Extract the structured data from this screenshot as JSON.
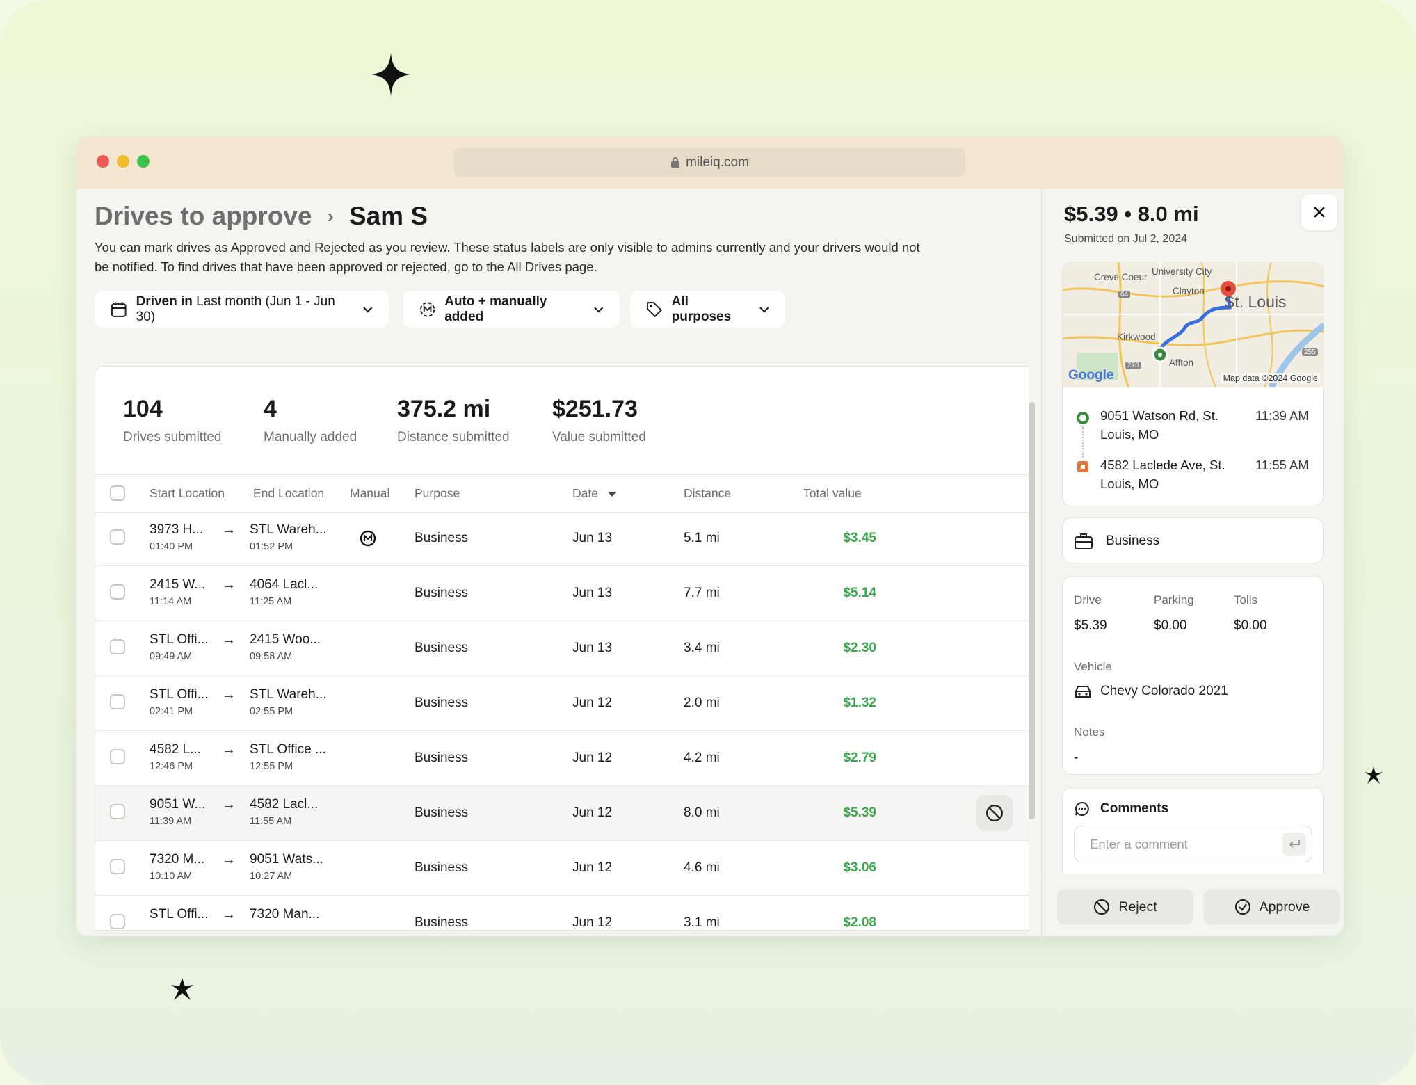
{
  "browser": {
    "url": "mileiq.com"
  },
  "breadcrumb": {
    "parent": "Drives to approve",
    "current": "Sam S"
  },
  "description": "You can mark drives as Approved and Rejected as you review. These status labels are only visible to admins currently and your drivers would not be notified. To find drives that have been approved or rejected, go to the All Drives page.",
  "filters": {
    "date_bold": "Driven in",
    "date_value": "Last month (Jun 1 - Jun 30)",
    "source": "Auto + manually added",
    "purpose": "All purposes"
  },
  "stats": [
    {
      "value": "104",
      "label": "Drives submitted"
    },
    {
      "value": "4",
      "label": "Manually added"
    },
    {
      "value": "375.2 mi",
      "label": "Distance submitted"
    },
    {
      "value": "$251.73",
      "label": "Value submitted"
    }
  ],
  "table": {
    "columns": [
      "Start Location",
      "End Location",
      "Manual",
      "Purpose",
      "Date",
      "Distance",
      "Total value"
    ],
    "rows": [
      {
        "start": "3973 H...",
        "start_time": "01:40 PM",
        "end": "STL Wareh...",
        "end_time": "01:52 PM",
        "manual": true,
        "purpose": "Business",
        "date": "Jun 13",
        "distance": "5.1 mi",
        "value": "$3.45"
      },
      {
        "start": "2415 W...",
        "start_time": "11:14 AM",
        "end": "4064 Lacl...",
        "end_time": "11:25 AM",
        "manual": false,
        "purpose": "Business",
        "date": "Jun 13",
        "distance": "7.7 mi",
        "value": "$5.14"
      },
      {
        "start": "STL Offi...",
        "start_time": "09:49 AM",
        "end": "2415 Woo...",
        "end_time": "09:58 AM",
        "manual": false,
        "purpose": "Business",
        "date": "Jun 13",
        "distance": "3.4 mi",
        "value": "$2.30"
      },
      {
        "start": "STL Offi...",
        "start_time": "02:41 PM",
        "end": "STL Wareh...",
        "end_time": "02:55 PM",
        "manual": false,
        "purpose": "Business",
        "date": "Jun 12",
        "distance": "2.0 mi",
        "value": "$1.32"
      },
      {
        "start": "4582 L...",
        "start_time": "12:46 PM",
        "end": "STL Office ...",
        "end_time": "12:55 PM",
        "manual": false,
        "purpose": "Business",
        "date": "Jun 12",
        "distance": "4.2 mi",
        "value": "$2.79"
      },
      {
        "start": "9051 W...",
        "start_time": "11:39 AM",
        "end": "4582 Lacl...",
        "end_time": "11:55 AM",
        "manual": false,
        "purpose": "Business",
        "date": "Jun 12",
        "distance": "8.0 mi",
        "value": "$5.39",
        "selected": true
      },
      {
        "start": "7320 M...",
        "start_time": "10:10 AM",
        "end": "9051 Wats...",
        "end_time": "10:27 AM",
        "manual": false,
        "purpose": "Business",
        "date": "Jun 12",
        "distance": "4.6 mi",
        "value": "$3.06"
      },
      {
        "start": "STL Offi...",
        "start_time": "",
        "end": "7320 Man...",
        "end_time": "",
        "manual": false,
        "purpose": "Business",
        "date": "Jun 12",
        "distance": "3.1 mi",
        "value": "$2.08"
      }
    ]
  },
  "detail": {
    "amount": "$5.39",
    "separator": "•",
    "distance": "8.0 mi",
    "submitted": "Submitted on Jul 2, 2024",
    "map": {
      "labels": [
        "Creve Coeur",
        "University City",
        "Clayton",
        "St. Louis",
        "Kirkwood",
        "Affton",
        "64",
        "270",
        "255"
      ],
      "brand": "Google",
      "attribution": "Map data ©2024 Google"
    },
    "start_address": "9051 Watson Rd, St. Louis, MO",
    "start_time": "11:39 AM",
    "end_address": "4582 Laclede Ave, St. Louis, MO",
    "end_time": "11:55 AM",
    "purpose": "Business",
    "drive_label": "Drive",
    "drive_value": "$5.39",
    "parking_label": "Parking",
    "parking_value": "$0.00",
    "tolls_label": "Tolls",
    "tolls_value": "$0.00",
    "vehicle_label": "Vehicle",
    "vehicle_value": "Chevy Colorado 2021",
    "notes_label": "Notes",
    "notes_value": "-",
    "comments_label": "Comments",
    "comment_placeholder": "Enter a comment",
    "reject_label": "Reject",
    "approve_label": "Approve"
  },
  "colors": {
    "background": "#edf8d6",
    "positive": "#3aa84c",
    "start_pin": "#3a8a3e",
    "end_pin": "#e8763a"
  }
}
